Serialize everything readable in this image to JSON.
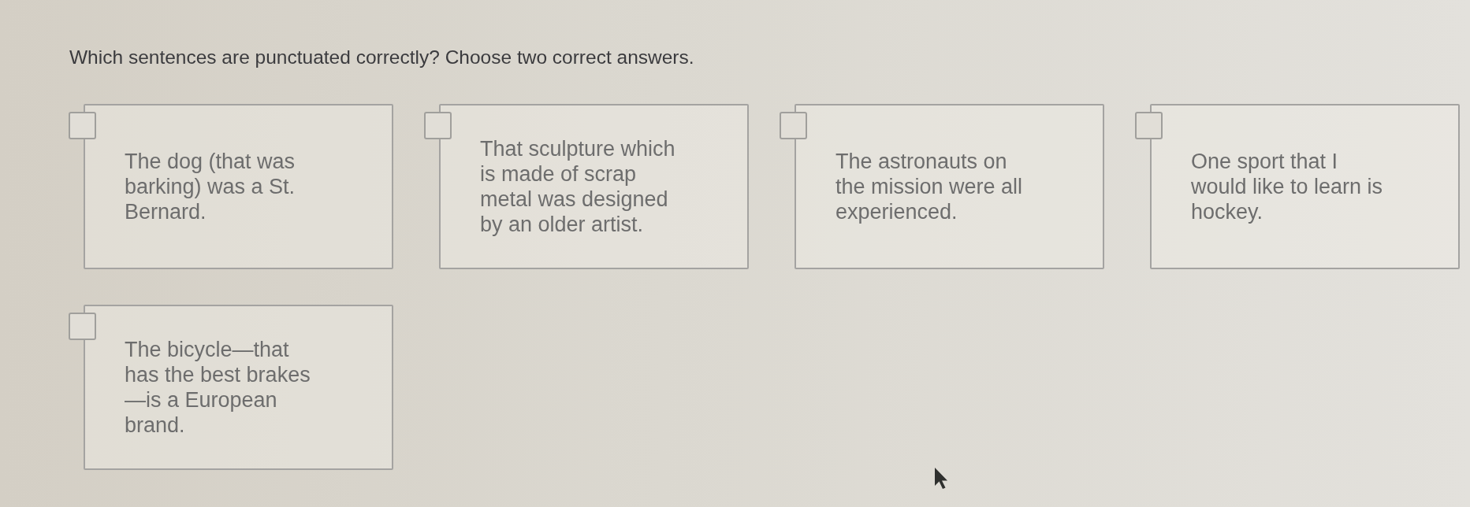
{
  "question": {
    "text": "Which sentences are punctuated correctly? Choose two correct answers."
  },
  "options": [
    {
      "text": "The dog (that was barking) was a St. Bernard.",
      "checked": false
    },
    {
      "text": "That sculpture which is made of scrap metal was designed by an older artist.",
      "checked": false
    },
    {
      "text": "The astronauts on the mission were all experienced.",
      "checked": false
    },
    {
      "text": "One sport that I would like to learn is hockey.",
      "checked": false
    },
    {
      "text": "The bicycle—that has the best brakes—is a European brand.",
      "checked": false
    }
  ]
}
